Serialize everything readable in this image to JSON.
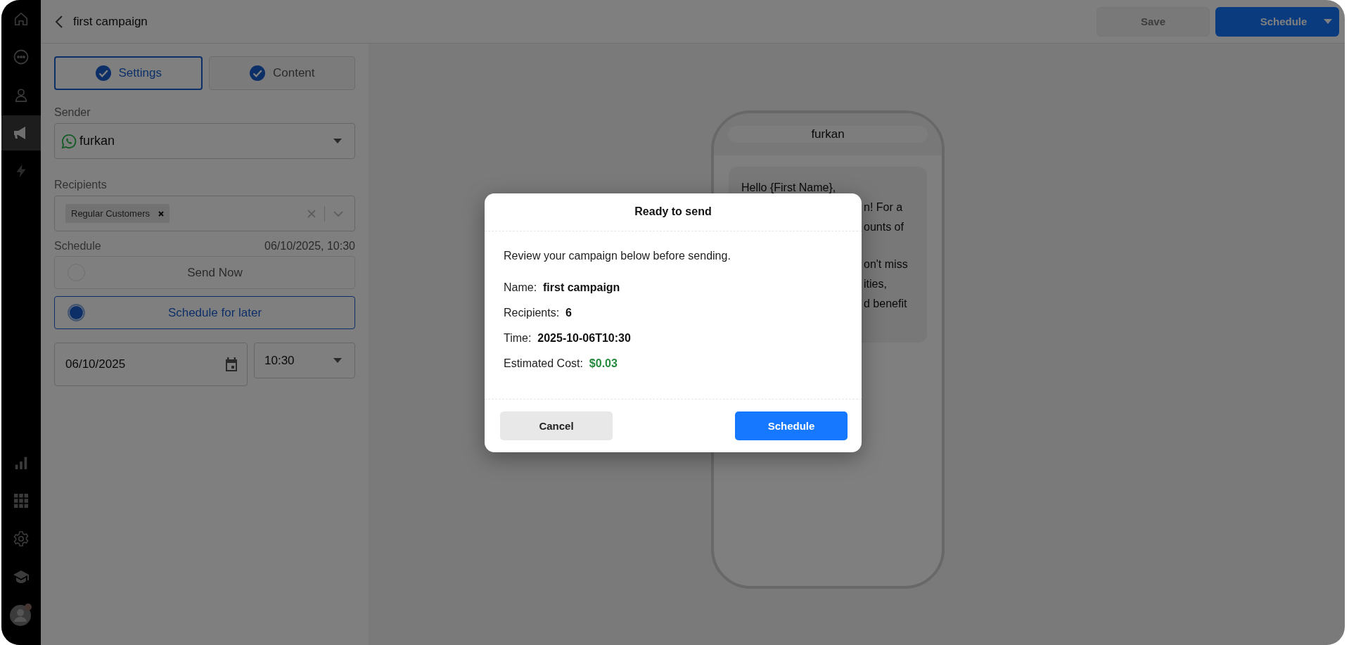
{
  "nav_items": [
    {
      "selected": false
    },
    {
      "selected": false
    },
    {
      "selected": false
    },
    {
      "selected": true
    },
    {
      "selected": false
    },
    {
      "selected": false
    },
    {
      "selected": false
    },
    {
      "selected": false
    },
    {
      "selected": false
    },
    {
      "selected": false
    }
  ],
  "header": {
    "title": "first campaign",
    "save": {
      "label": "Save",
      "disabled": true
    },
    "schedule": {
      "label": "Schedule"
    }
  },
  "steps": [
    {
      "label": "Settings",
      "selected": true,
      "done": true
    },
    {
      "label": "Content",
      "selected": false,
      "done": true
    }
  ],
  "sender": {
    "label": "Sender",
    "value": "furkan"
  },
  "recipients": {
    "label": "Recipients",
    "chips": [
      "Regular Customers"
    ]
  },
  "schedule": {
    "label": "Schedule",
    "summary": "06/10/2025, 10:30",
    "options": [
      {
        "label": "Send Now",
        "selected": false
      },
      {
        "label": "Schedule for later",
        "selected": true
      }
    ],
    "date": "06/10/2025",
    "time": "10:30"
  },
  "preview": {
    "sender": "furkan",
    "paragraphs": [
      [
        {
          "text": "Hello {First Name},",
          "kind": "line"
        },
        {
          "text": "n! For a",
          "kind": "tail"
        },
        {
          "text": "ounts of",
          "kind": "tail"
        }
      ],
      [
        {
          "text": "on't miss",
          "kind": "tail"
        },
        {
          "text": "ities,",
          "kind": "tail"
        },
        {
          "text": "d benefit",
          "kind": "tail"
        }
      ]
    ]
  },
  "modal": {
    "title": "Ready to send",
    "intro": "Review your campaign below before sending.",
    "fields": [
      {
        "label": "Name:",
        "value": "first campaign",
        "kind": "plain"
      },
      {
        "label": "Recipients:",
        "value": "6",
        "kind": "plain"
      },
      {
        "label": "Time:",
        "value": "2025-10-06T10:30",
        "kind": "plain"
      },
      {
        "label": "Estimated Cost:",
        "value": "$0.03",
        "kind": "cost"
      }
    ],
    "buttons": [
      {
        "label": "Cancel",
        "kind": "secondary"
      },
      {
        "label": "Schedule",
        "kind": "primary"
      }
    ]
  }
}
